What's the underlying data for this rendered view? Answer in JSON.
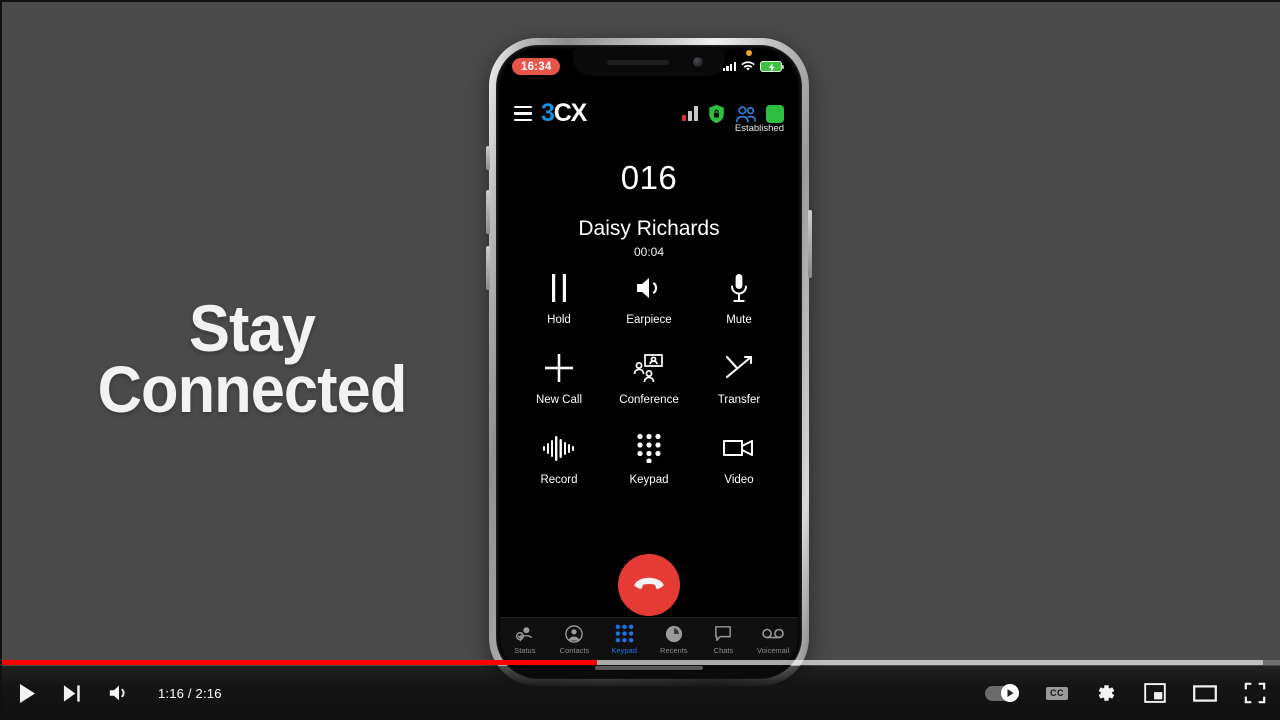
{
  "video": {
    "overlay_headline_line1": "Stay",
    "overlay_headline_line2": "Connected"
  },
  "phone": {
    "ios_status": {
      "recording_time": "16:34",
      "signal_icon": "cellular-bars-icon",
      "wifi_icon": "wifi-icon",
      "battery_icon": "battery-charging-icon",
      "privacy_dot": "orange-privacy-dot-icon"
    },
    "app_header": {
      "menu_icon": "hamburger-menu-icon",
      "logo_prefix": "3",
      "logo_suffix": "CX",
      "signal_icon": "call-quality-bars-icon",
      "security_icon": "shield-lock-icon",
      "participants_icon": "people-icon",
      "status_square_icon": "green-status-square-icon",
      "connection_status": "Established"
    },
    "call": {
      "number": "016",
      "caller_name": "Daisy Richards",
      "duration": "00:04",
      "end_call_icon": "end-call-handset-icon"
    },
    "controls": [
      {
        "label": "Hold",
        "icon": "pause-icon"
      },
      {
        "label": "Earpiece",
        "icon": "speaker-icon"
      },
      {
        "label": "Mute",
        "icon": "microphone-icon"
      },
      {
        "label": "New Call",
        "icon": "plus-icon"
      },
      {
        "label": "Conference",
        "icon": "conference-people-icon"
      },
      {
        "label": "Transfer",
        "icon": "transfer-arrow-icon"
      },
      {
        "label": "Record",
        "icon": "waveform-icon"
      },
      {
        "label": "Keypad",
        "icon": "dialpad-icon"
      },
      {
        "label": "Video",
        "icon": "video-camera-icon"
      }
    ],
    "tabs": [
      {
        "label": "Status",
        "icon": "status-person-icon",
        "active": false
      },
      {
        "label": "Contacts",
        "icon": "contacts-person-icon",
        "active": false
      },
      {
        "label": "Keypad",
        "icon": "dialpad-icon",
        "active": true
      },
      {
        "label": "Recents",
        "icon": "clock-icon",
        "active": false
      },
      {
        "label": "Chats",
        "icon": "chat-bubble-icon",
        "active": false
      },
      {
        "label": "Voicemail",
        "icon": "voicemail-icon",
        "active": false
      }
    ]
  },
  "player": {
    "play_icon": "play-icon",
    "next_icon": "next-video-icon",
    "volume_icon": "volume-icon",
    "time_display": "1:16 / 2:16",
    "current_time": "1:16",
    "total_time": "2:16",
    "progress_percent": 46.5,
    "buffered_percent": 98.5,
    "autoplay_label": "autoplay-toggle",
    "autoplay_on": true,
    "cc_label": "CC",
    "settings_icon": "gear-icon",
    "miniplayer_icon": "miniplayer-icon",
    "theater_icon": "theater-mode-icon",
    "fullscreen_icon": "fullscreen-icon"
  },
  "colors": {
    "accent_red": "#ff0000",
    "brand_blue": "#1a8fdb",
    "tab_active_blue": "#1a73e8",
    "end_call_red": "#e63b34",
    "status_green": "#2fbf3f",
    "background_gray": "#4a4a4a"
  }
}
